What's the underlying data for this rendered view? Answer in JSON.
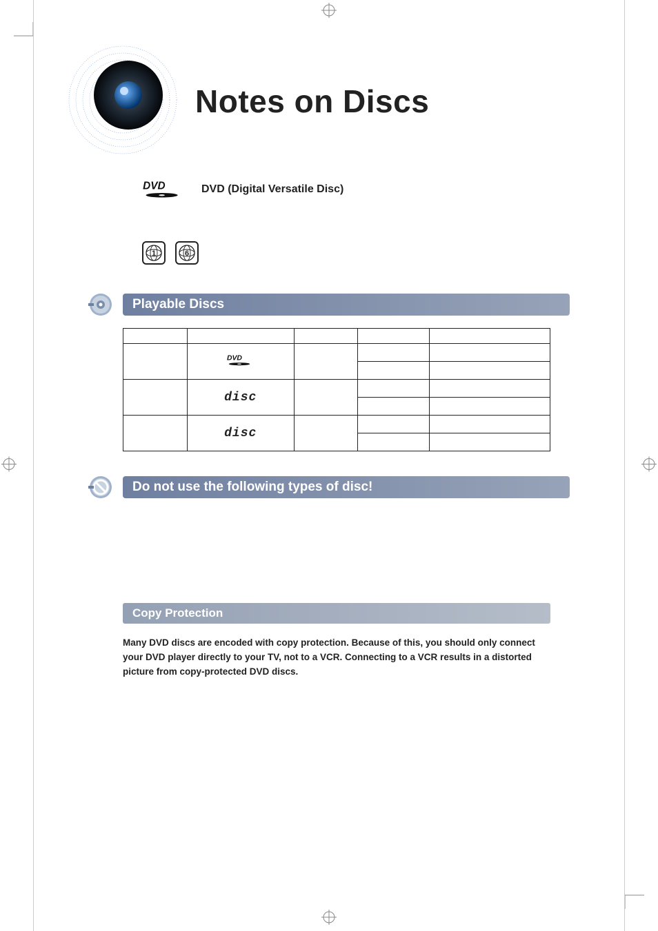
{
  "header": {
    "title": "Notes on Discs"
  },
  "dvd_line": {
    "label": "DVD (Digital Versatile Disc)"
  },
  "region_badges": {
    "first": "1",
    "second": "6"
  },
  "sections": {
    "playable": {
      "title": "Playable Discs",
      "table": {
        "header": [
          "",
          "",
          "",
          "",
          ""
        ],
        "rows": [
          {
            "c1": "",
            "logo": "dvd",
            "c3": "",
            "c4_top": "",
            "c5_top": "",
            "c4_bot": "",
            "c5_bot": ""
          },
          {
            "c1": "",
            "logo": "disc",
            "c3": "",
            "c4_top": "",
            "c5_top": "",
            "c4_bot": "",
            "c5_bot": ""
          },
          {
            "c1": "",
            "logo": "disc",
            "c3": "",
            "c4_top": "",
            "c5_top": "",
            "c4_bot": "",
            "c5_bot": ""
          }
        ]
      }
    },
    "do_not_use": {
      "title": "Do not use the following types of disc!"
    },
    "copy_protection": {
      "title": "Copy Protection",
      "body": "Many DVD discs are encoded with copy protection. Because of this, you should only connect your DVD player directly to your TV, not to a VCR. Connecting to a VCR results in a distorted picture from copy-protected DVD discs."
    }
  }
}
